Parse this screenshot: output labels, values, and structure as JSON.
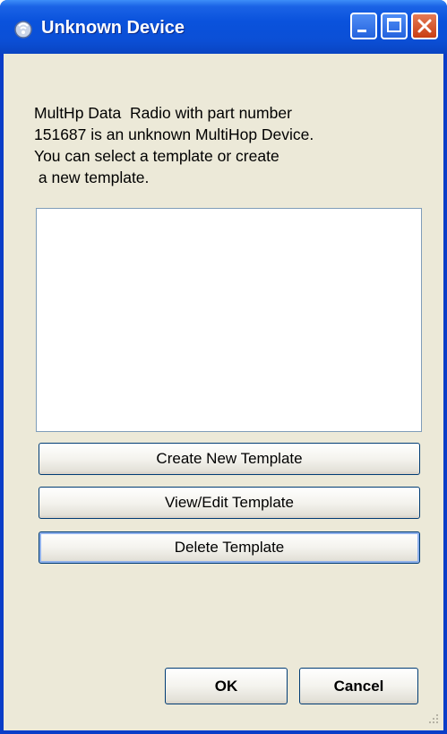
{
  "window": {
    "title": "Unknown Device",
    "title_icon": "device-icon",
    "controls": [
      "minimize-icon",
      "maximize-icon",
      "close-icon"
    ],
    "colors": {
      "titlebar": "#0a52dc",
      "frame": "#0a3dc8",
      "body": "#ece9d8",
      "close_button": "#c83d13"
    }
  },
  "dialog": {
    "message": "MultHp Data  Radio with part number\n151687 is an unknown MultiHop Device.\nYou can select a template or create\n a new template.",
    "template_list": []
  },
  "buttons": {
    "create": "Create New Template",
    "view_edit": "View/Edit Template",
    "delete": "Delete Template",
    "ok": "OK",
    "cancel": "Cancel"
  }
}
